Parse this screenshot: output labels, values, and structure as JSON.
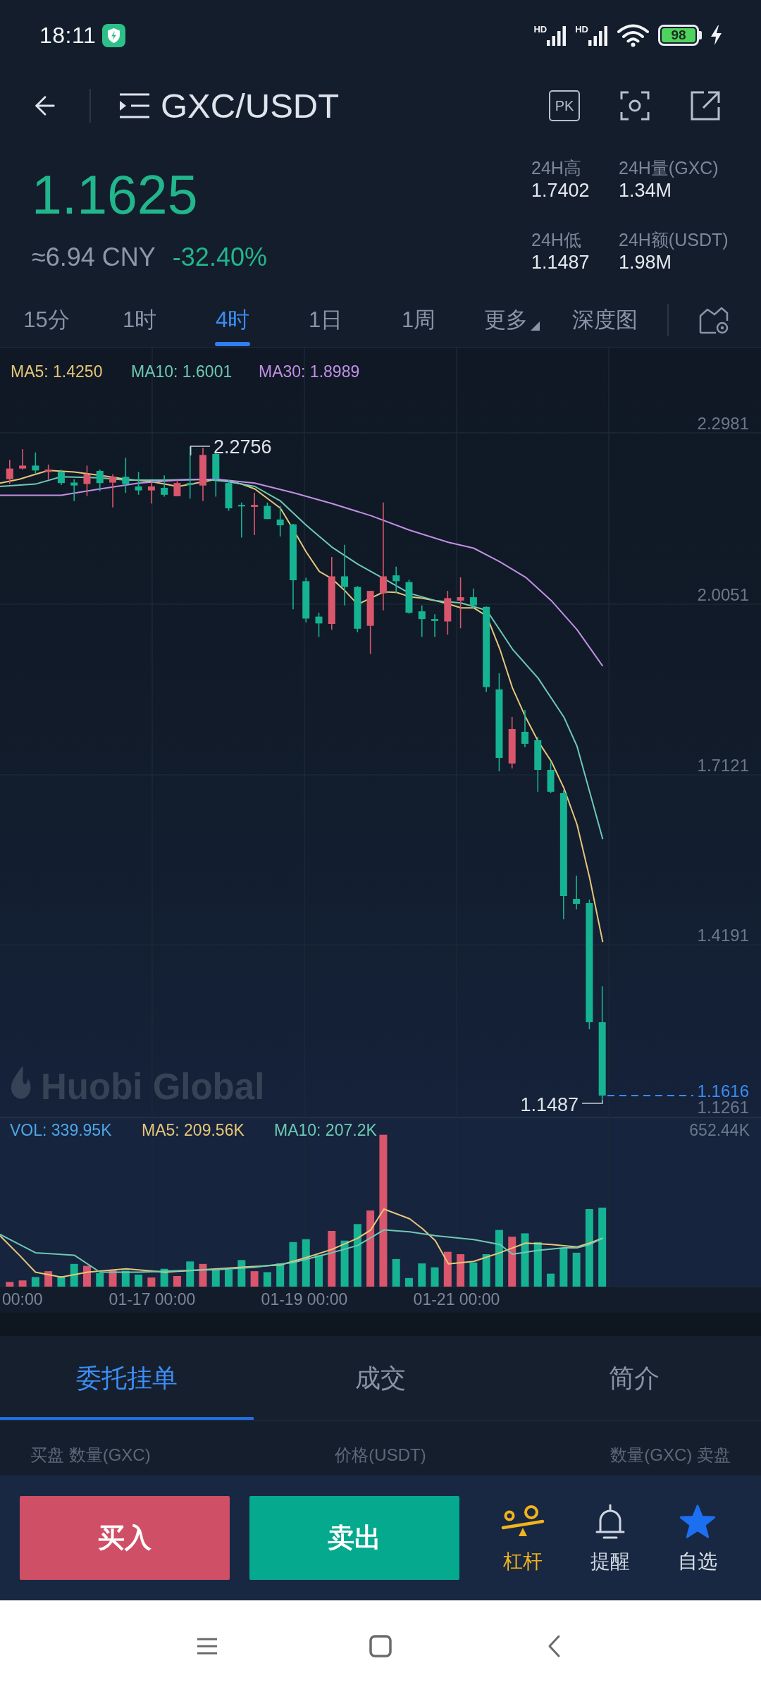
{
  "status_bar": {
    "time": "18:11",
    "signals": [
      {
        "label": "HD"
      },
      {
        "label": "HD"
      }
    ],
    "battery": "98"
  },
  "header": {
    "pair": "GXC/USDT",
    "pk_label": "PK"
  },
  "ticker": {
    "price": "1.1625",
    "cny": "≈6.94 CNY",
    "change": "-32.40%",
    "stats": [
      {
        "label": "24H高",
        "value": "1.7402"
      },
      {
        "label": "24H量(GXC)",
        "value": "1.34M"
      },
      {
        "label": "24H低",
        "value": "1.1487"
      },
      {
        "label": "24H额(USDT)",
        "value": "1.98M"
      }
    ]
  },
  "intervals": [
    {
      "label": "15分",
      "selected": false,
      "kind": "period"
    },
    {
      "label": "1时",
      "selected": false,
      "kind": "period"
    },
    {
      "label": "4时",
      "selected": true,
      "kind": "period"
    },
    {
      "label": "1日",
      "selected": false,
      "kind": "period"
    },
    {
      "label": "1周",
      "selected": false,
      "kind": "period"
    },
    {
      "label": "更多",
      "selected": false,
      "kind": "menu"
    },
    {
      "label": "深度图",
      "selected": false,
      "kind": "period"
    }
  ],
  "chart": {
    "legend": [
      {
        "label": "MA5: 1.4250",
        "color": "#e6c679"
      },
      {
        "label": "MA10: 1.6001",
        "color": "#6ec9b4"
      },
      {
        "label": "MA30: 1.8989",
        "color": "#c28fe6"
      }
    ],
    "price_labels": [
      "2.2981",
      "2.0051",
      "1.7121",
      "1.4191",
      "1.1261"
    ],
    "high_marker": "2.2756",
    "low_marker": "1.1487",
    "last_price": "1.1616",
    "watermark": "Huobi Global"
  },
  "volume": {
    "legend": [
      {
        "label": "VOL: 339.95K",
        "color": "#4ea6e8"
      },
      {
        "label": "MA5: 209.56K",
        "color": "#e6c679"
      },
      {
        "label": "MA10: 207.2K",
        "color": "#6ec9b4"
      }
    ],
    "max_label": "652.44K",
    "dates": [
      "00:00",
      "01-17 00:00",
      "01-19 00:00",
      "01-21 00:00"
    ]
  },
  "detail_tabs": [
    {
      "label": "委托挂单",
      "selected": true
    },
    {
      "label": "成交",
      "selected": false
    },
    {
      "label": "简介",
      "selected": false
    }
  ],
  "order_book": {
    "columns": [
      "买盘 数量(GXC)",
      "价格(USDT)",
      "数量(GXC) 卖盘"
    ]
  },
  "actions": {
    "buy": "买入",
    "sell": "卖出",
    "shortcuts": [
      {
        "label": "杠杆",
        "kind": "leverage"
      },
      {
        "label": "提醒",
        "kind": "alert"
      }
    ],
    "favorite": {
      "label": "自选",
      "starred": true
    }
  }
}
